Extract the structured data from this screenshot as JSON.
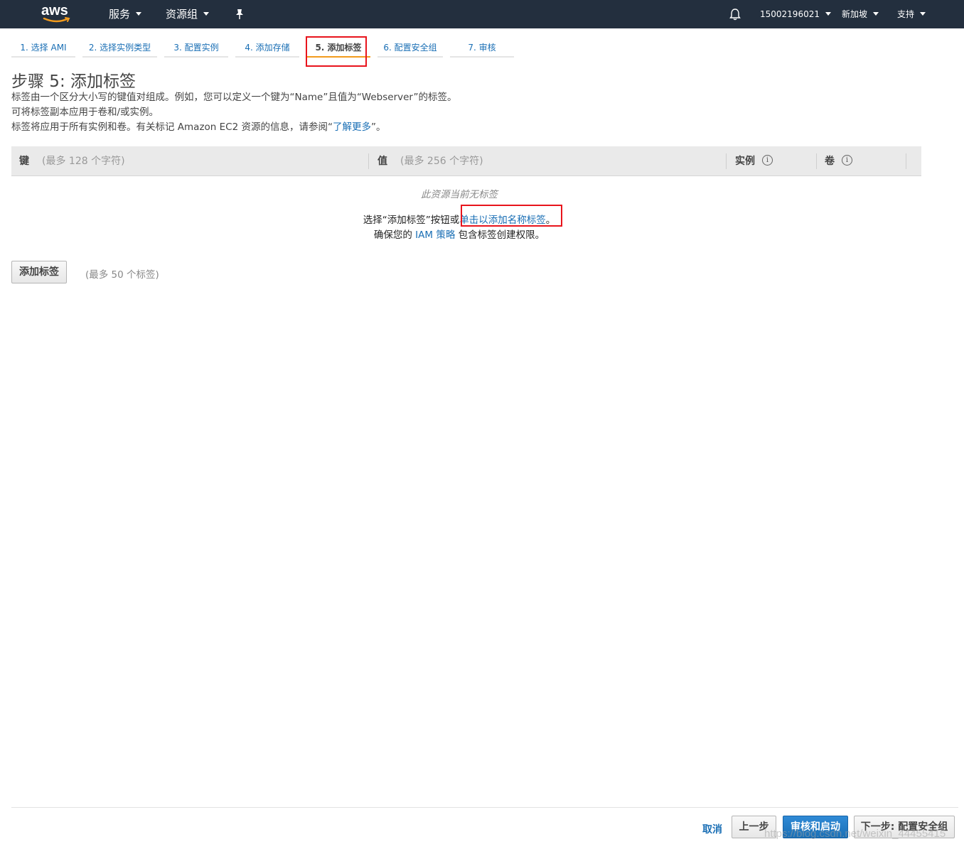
{
  "topbar": {
    "logo_text": "aws",
    "services": "服务",
    "resource_groups": "资源组",
    "account": "15002196021",
    "region": "新加坡",
    "support": "支持"
  },
  "wizard_tabs": [
    {
      "label": "1. 选择 AMI"
    },
    {
      "label": "2. 选择实例类型"
    },
    {
      "label": "3. 配置实例"
    },
    {
      "label": "4. 添加存储"
    },
    {
      "label": "5. 添加标签",
      "active": true
    },
    {
      "label": "6. 配置安全组"
    },
    {
      "label": "7. 审核"
    }
  ],
  "page": {
    "title": "步骤 5: 添加标签",
    "desc1": "标签由一个区分大小写的键值对组成。例如，您可以定义一个键为“Name”且值为“Webserver”的标签。",
    "desc2": "可将标签副本应用于卷和/或实例。",
    "desc3_prefix": "标签将应用于所有实例和卷。有关标记 Amazon EC2 资源的信息，请参阅“",
    "desc3_link": "了解更多",
    "desc3_suffix": "”。"
  },
  "table": {
    "key_header": "键",
    "key_hint": "(最多 128 个字符)",
    "value_header": "值",
    "value_hint": "(最多 256 个字符)",
    "instance_header": "实例",
    "volume_header": "卷",
    "info_glyph": "i"
  },
  "empty_state": {
    "message": "此资源当前无标签",
    "line1_prefix": "选择“添加标签”按钮或",
    "line1_link": "单击以添加名称标签",
    "line1_suffix": "。",
    "line2_prefix": "确保您的 ",
    "line2_link": "IAM 策略",
    "line2_suffix": " 包含标签创建权限。"
  },
  "add_tag": {
    "button": "添加标签",
    "hint": "(最多 50 个标签)"
  },
  "footer": {
    "cancel": "取消",
    "previous": "上一步",
    "review_launch": "审核和启动",
    "next": "下一步: 配置安全组"
  },
  "watermark": "https://blog.csdn.net/weixin_44455415",
  "colors": {
    "nav_bg": "#232f3e",
    "link": "#1a6fb5",
    "active_tab_underline": "#f29b1d",
    "highlight_box": "#e8141c",
    "primary_button": "#1a6fb5"
  }
}
